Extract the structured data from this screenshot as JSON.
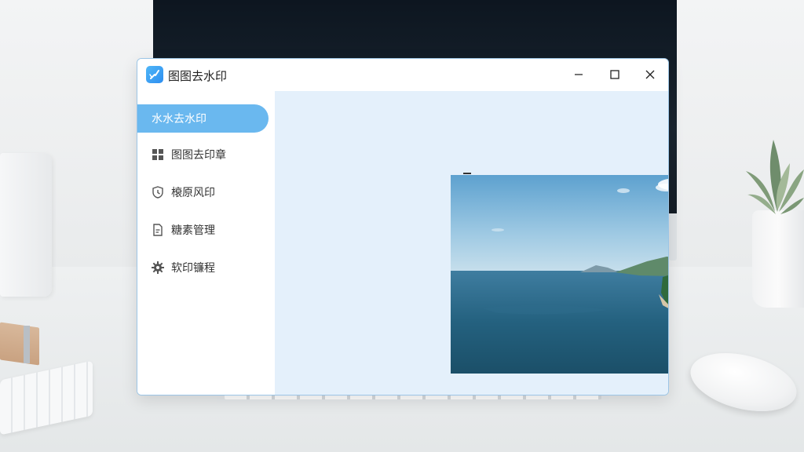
{
  "app": {
    "title": "图图去水印",
    "logo_icon": "brush-logo-icon",
    "accent_color": "#6ab8ef",
    "content_bg_color": "#e4f0fb"
  },
  "window_controls": {
    "minimize_icon": "minimize-icon",
    "maximize_icon": "maximize-icon",
    "close_icon": "close-icon"
  },
  "sidebar": {
    "items": [
      {
        "label": "水水去水印",
        "icon": "none",
        "active": true
      },
      {
        "label": "图图去印章",
        "icon": "grid-icon",
        "active": false
      },
      {
        "label": "榱原风印",
        "icon": "shield-clock-icon",
        "active": false
      },
      {
        "label": "糖素管理",
        "icon": "document-icon",
        "active": false
      },
      {
        "label": "软印镰程",
        "icon": "gear-icon",
        "active": false
      }
    ]
  },
  "preview": {
    "subject": "coastal landscape photo"
  }
}
